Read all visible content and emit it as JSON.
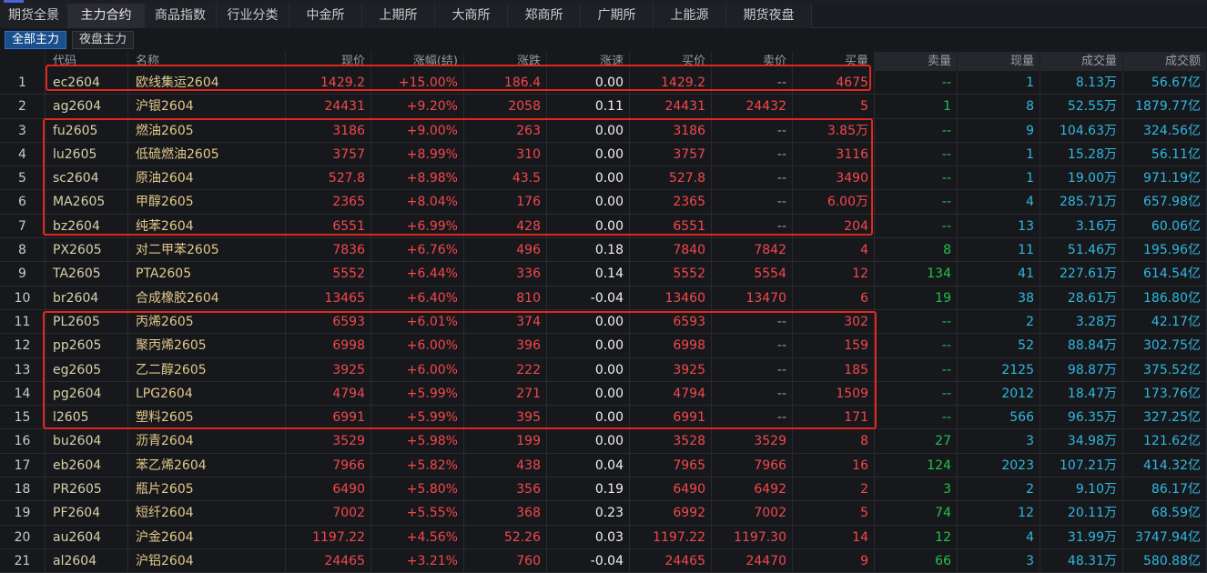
{
  "tabs": [
    "期货全景",
    "主力合约",
    "商品指数",
    "行业分类",
    "中金所",
    "上期所",
    "大商所",
    "郑商所",
    "广期所",
    "上能源",
    "期货夜盘"
  ],
  "active_tab": "主力合约",
  "subtabs": [
    "全部主力",
    "夜盘主力"
  ],
  "active_subtab": "全部主力",
  "columns": {
    "code": "代码",
    "name": "名称",
    "price": "现价",
    "pct": "涨幅(结)",
    "chg": "涨跌",
    "speed": "涨速",
    "buy": "买价",
    "sell": "卖价",
    "bvol": "买量",
    "svol": "卖量",
    "cur": "现量",
    "vol": "成交量",
    "amt": "成交额"
  },
  "rows": [
    {
      "idx": "1",
      "code": "ec2604",
      "name": "欧线集运2604",
      "price": "1429.2",
      "pct": "+15.00%",
      "chg": "186.4",
      "speed": "0.00",
      "buy": "1429.2",
      "sell": "--",
      "bvol": "4675",
      "svol": "--",
      "cur": "1",
      "vol": "8.13万",
      "amt": "56.67亿"
    },
    {
      "idx": "2",
      "code": "ag2604",
      "name": "沪银2604",
      "price": "24431",
      "pct": "+9.20%",
      "chg": "2058",
      "speed": "0.11",
      "buy": "24431",
      "sell": "24432",
      "bvol": "5",
      "svol": "1",
      "cur": "8",
      "vol": "52.55万",
      "amt": "1879.77亿"
    },
    {
      "idx": "3",
      "code": "fu2605",
      "name": "燃油2605",
      "price": "3186",
      "pct": "+9.00%",
      "chg": "263",
      "speed": "0.00",
      "buy": "3186",
      "sell": "--",
      "bvol": "3.85万",
      "svol": "--",
      "cur": "9",
      "vol": "104.63万",
      "amt": "324.56亿"
    },
    {
      "idx": "4",
      "code": "lu2605",
      "name": "低硫燃油2605",
      "price": "3757",
      "pct": "+8.99%",
      "chg": "310",
      "speed": "0.00",
      "buy": "3757",
      "sell": "--",
      "bvol": "3116",
      "svol": "--",
      "cur": "1",
      "vol": "15.28万",
      "amt": "56.11亿"
    },
    {
      "idx": "5",
      "code": "sc2604",
      "name": "原油2604",
      "price": "527.8",
      "pct": "+8.98%",
      "chg": "43.5",
      "speed": "0.00",
      "buy": "527.8",
      "sell": "--",
      "bvol": "3490",
      "svol": "--",
      "cur": "1",
      "vol": "19.00万",
      "amt": "971.19亿"
    },
    {
      "idx": "6",
      "code": "MA2605",
      "name": "甲醇2605",
      "price": "2365",
      "pct": "+8.04%",
      "chg": "176",
      "speed": "0.00",
      "buy": "2365",
      "sell": "--",
      "bvol": "6.00万",
      "svol": "--",
      "cur": "4",
      "vol": "285.71万",
      "amt": "657.98亿"
    },
    {
      "idx": "7",
      "code": "bz2604",
      "name": "纯苯2604",
      "price": "6551",
      "pct": "+6.99%",
      "chg": "428",
      "speed": "0.00",
      "buy": "6551",
      "sell": "--",
      "bvol": "204",
      "svol": "--",
      "cur": "13",
      "vol": "3.16万",
      "amt": "60.06亿"
    },
    {
      "idx": "8",
      "code": "PX2605",
      "name": "对二甲苯2605",
      "price": "7836",
      "pct": "+6.76%",
      "chg": "496",
      "speed": "0.18",
      "buy": "7840",
      "sell": "7842",
      "bvol": "4",
      "svol": "8",
      "cur": "11",
      "vol": "51.46万",
      "amt": "195.96亿"
    },
    {
      "idx": "9",
      "code": "TA2605",
      "name": "PTA2605",
      "price": "5552",
      "pct": "+6.44%",
      "chg": "336",
      "speed": "0.14",
      "buy": "5552",
      "sell": "5554",
      "bvol": "12",
      "svol": "134",
      "cur": "41",
      "vol": "227.61万",
      "amt": "614.54亿"
    },
    {
      "idx": "10",
      "code": "br2604",
      "name": "合成橡胶2604",
      "price": "13465",
      "pct": "+6.40%",
      "chg": "810",
      "speed": "-0.04",
      "buy": "13460",
      "sell": "13470",
      "bvol": "6",
      "svol": "19",
      "cur": "38",
      "vol": "28.61万",
      "amt": "186.80亿"
    },
    {
      "idx": "11",
      "code": "PL2605",
      "name": "丙烯2605",
      "price": "6593",
      "pct": "+6.01%",
      "chg": "374",
      "speed": "0.00",
      "buy": "6593",
      "sell": "--",
      "bvol": "302",
      "svol": "--",
      "cur": "2",
      "vol": "3.28万",
      "amt": "42.17亿"
    },
    {
      "idx": "12",
      "code": "pp2605",
      "name": "聚丙烯2605",
      "price": "6998",
      "pct": "+6.00%",
      "chg": "396",
      "speed": "0.00",
      "buy": "6998",
      "sell": "--",
      "bvol": "159",
      "svol": "--",
      "cur": "52",
      "vol": "88.84万",
      "amt": "302.75亿"
    },
    {
      "idx": "13",
      "code": "eg2605",
      "name": "乙二醇2605",
      "price": "3925",
      "pct": "+6.00%",
      "chg": "222",
      "speed": "0.00",
      "buy": "3925",
      "sell": "--",
      "bvol": "185",
      "svol": "--",
      "cur": "2125",
      "vol": "98.87万",
      "amt": "375.52亿"
    },
    {
      "idx": "14",
      "code": "pg2604",
      "name": "LPG2604",
      "price": "4794",
      "pct": "+5.99%",
      "chg": "271",
      "speed": "0.00",
      "buy": "4794",
      "sell": "--",
      "bvol": "1509",
      "svol": "--",
      "cur": "2012",
      "vol": "18.47万",
      "amt": "173.76亿"
    },
    {
      "idx": "15",
      "code": "l2605",
      "name": "塑料2605",
      "price": "6991",
      "pct": "+5.99%",
      "chg": "395",
      "speed": "0.00",
      "buy": "6991",
      "sell": "--",
      "bvol": "171",
      "svol": "--",
      "cur": "566",
      "vol": "96.35万",
      "amt": "327.25亿"
    },
    {
      "idx": "16",
      "code": "bu2604",
      "name": "沥青2604",
      "price": "3529",
      "pct": "+5.98%",
      "chg": "199",
      "speed": "0.00",
      "buy": "3528",
      "sell": "3529",
      "bvol": "8",
      "svol": "27",
      "cur": "3",
      "vol": "34.98万",
      "amt": "121.62亿"
    },
    {
      "idx": "17",
      "code": "eb2604",
      "name": "苯乙烯2604",
      "price": "7966",
      "pct": "+5.82%",
      "chg": "438",
      "speed": "0.04",
      "buy": "7965",
      "sell": "7966",
      "bvol": "16",
      "svol": "124",
      "cur": "2023",
      "vol": "107.21万",
      "amt": "414.32亿"
    },
    {
      "idx": "18",
      "code": "PR2605",
      "name": "瓶片2605",
      "price": "6490",
      "pct": "+5.80%",
      "chg": "356",
      "speed": "0.19",
      "buy": "6490",
      "sell": "6492",
      "bvol": "2",
      "svol": "3",
      "cur": "2",
      "vol": "9.10万",
      "amt": "86.17亿"
    },
    {
      "idx": "19",
      "code": "PF2604",
      "name": "短纤2604",
      "price": "7002",
      "pct": "+5.55%",
      "chg": "368",
      "speed": "0.23",
      "buy": "6992",
      "sell": "7002",
      "bvol": "5",
      "svol": "74",
      "cur": "12",
      "vol": "20.11万",
      "amt": "68.59亿"
    },
    {
      "idx": "20",
      "code": "au2604",
      "name": "沪金2604",
      "price": "1197.22",
      "pct": "+4.56%",
      "chg": "52.26",
      "speed": "0.03",
      "buy": "1197.22",
      "sell": "1197.30",
      "bvol": "14",
      "svol": "12",
      "cur": "4",
      "vol": "31.99万",
      "amt": "3747.94亿"
    },
    {
      "idx": "21",
      "code": "al2604",
      "name": "沪铝2604",
      "price": "24465",
      "pct": "+3.21%",
      "chg": "760",
      "speed": "-0.04",
      "buy": "24465",
      "sell": "24470",
      "bvol": "9",
      "svol": "66",
      "cur": "3",
      "vol": "48.31万",
      "amt": "580.88亿"
    }
  ],
  "colors": {
    "up": "#f2484c",
    "down": "#1fc24a",
    "neutral": "#f0f0f0",
    "volume": "#2fb8e0",
    "highlight_box": "#e0271e",
    "active_subtab": "#1a4f8e"
  }
}
